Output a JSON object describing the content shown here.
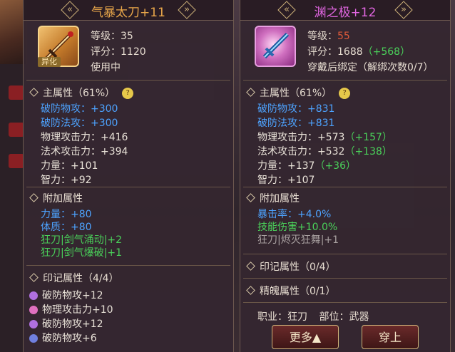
{
  "left_item": {
    "name": "气暴太刀+11",
    "name_color": "#e8a64a",
    "icon": "sword-icon",
    "badge": "异化",
    "level_label": "等级：",
    "level": "35",
    "score_label": "评分：",
    "score": "1120",
    "status": "使用中",
    "main_title": "主属性（61%）",
    "main_stats": [
      {
        "text": "破防物攻：+300",
        "color": "blue"
      },
      {
        "text": "破防法攻：+300",
        "color": "blue"
      },
      {
        "text": "物理攻击力：+416",
        "color": "white"
      },
      {
        "text": "法术攻击力：+394",
        "color": "white"
      },
      {
        "text": "力量：+101",
        "color": "white"
      },
      {
        "text": "智力：+92",
        "color": "white"
      }
    ],
    "extra_title": "附加属性",
    "extra_stats": [
      {
        "text": "力量：+80",
        "color": "blue"
      },
      {
        "text": "体质：+80",
        "color": "blue"
      },
      {
        "text": "狂刀|剑气涌动|+2",
        "color": "green"
      },
      {
        "text": "狂刀|剑气爆破|+1",
        "color": "green"
      }
    ],
    "mark_title": "印记属性（4/4）",
    "mark_stats": [
      {
        "text": "破防物攻+12",
        "gem": "#b070e0"
      },
      {
        "text": "物理攻击力+10",
        "gem": "#e070c0"
      },
      {
        "text": "破防物攻+12",
        "gem": "#b070e0"
      },
      {
        "text": "破防物攻+6",
        "gem": "#7080e0"
      }
    ]
  },
  "right_item": {
    "name": "渊之极+12",
    "name_color": "#e066e0",
    "icon": "blade-icon",
    "level_label": "等级：",
    "level": "55",
    "score_label": "评分：",
    "score": "1688",
    "score_delta": "（+568）",
    "bind": "穿戴后绑定（解绑次数0/7）",
    "main_title": "主属性（61%）",
    "main_stats": [
      {
        "text": "破防物攻：+831",
        "delta": "",
        "color": "blue"
      },
      {
        "text": "破防法攻：+831",
        "delta": "",
        "color": "blue"
      },
      {
        "text": "物理攻击力：+573",
        "delta": "（+157）",
        "color": "white"
      },
      {
        "text": "法术攻击力：+532",
        "delta": "（+138）",
        "color": "white"
      },
      {
        "text": "力量：+137",
        "delta": "（+36）",
        "color": "white"
      },
      {
        "text": "智力：+107",
        "delta": "",
        "color": "white"
      }
    ],
    "extra_title": "附加属性",
    "extra_stats": [
      {
        "text": "暴击率：+4.0%",
        "color": "blue"
      },
      {
        "text": "技能伤害+10.0%",
        "color": "green"
      },
      {
        "text": "狂刀|烬灭狂舞|+1",
        "color": "grey"
      }
    ],
    "mark_title": "印记属性（0/4）",
    "soul_title": "精魄属性（0/1）",
    "job_label": "职业：",
    "job": "狂刀",
    "slot_label": "部位：",
    "slot": "武器",
    "more_button": "更多▲",
    "equip_button": "穿上"
  }
}
